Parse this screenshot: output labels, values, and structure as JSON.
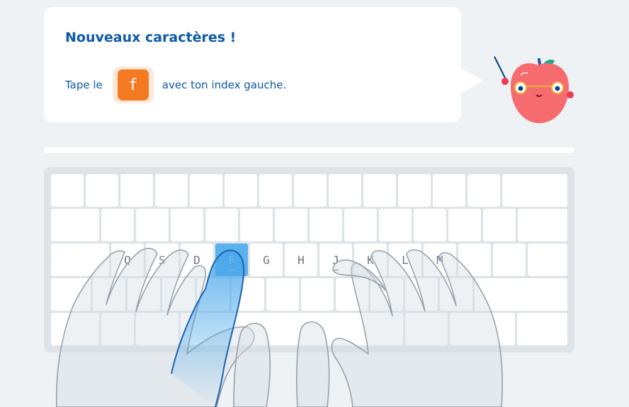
{
  "lesson": {
    "title": "Nouveaux caractères !",
    "instruction_before": "Tape le",
    "target_key": "f",
    "instruction_after": "avec ton index gauche."
  },
  "progress": {
    "fraction": 0
  },
  "keyboard": {
    "home_row_labels": [
      "Q",
      "S",
      "D",
      "F",
      "G",
      "H",
      "J",
      "K",
      "L",
      "M"
    ],
    "highlighted_key": "F",
    "guiding_finger": "left-index"
  },
  "colors": {
    "title": "#0c5aa6",
    "key_chip": "#f47a22",
    "highlighted_key": "#5ab1ec",
    "finger_highlight": "#4aa7ea",
    "background": "#eef2f5"
  },
  "icons": {
    "mascot": "apple-teacher-mascot",
    "hands": "hands-overlay"
  }
}
